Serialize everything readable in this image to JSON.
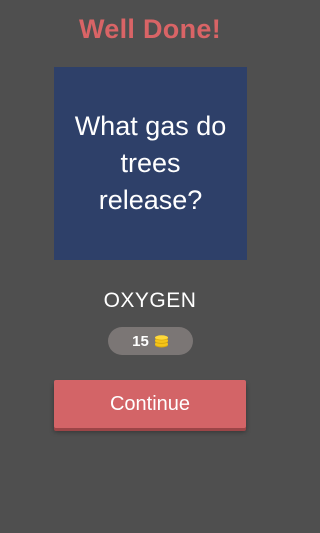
{
  "header": {
    "title": "Well Done!"
  },
  "question": {
    "text": "What gas do trees release?"
  },
  "answer": {
    "text": "OXYGEN"
  },
  "reward": {
    "amount": "15",
    "icon": "coin-stack-icon"
  },
  "actions": {
    "continue_label": "Continue"
  },
  "colors": {
    "background": "#4f4f4f",
    "title": "#d96466",
    "question_card": "#2e4069",
    "reward_pill": "#7b7675",
    "coin": "#f5c518",
    "continue_button": "#d36467"
  }
}
